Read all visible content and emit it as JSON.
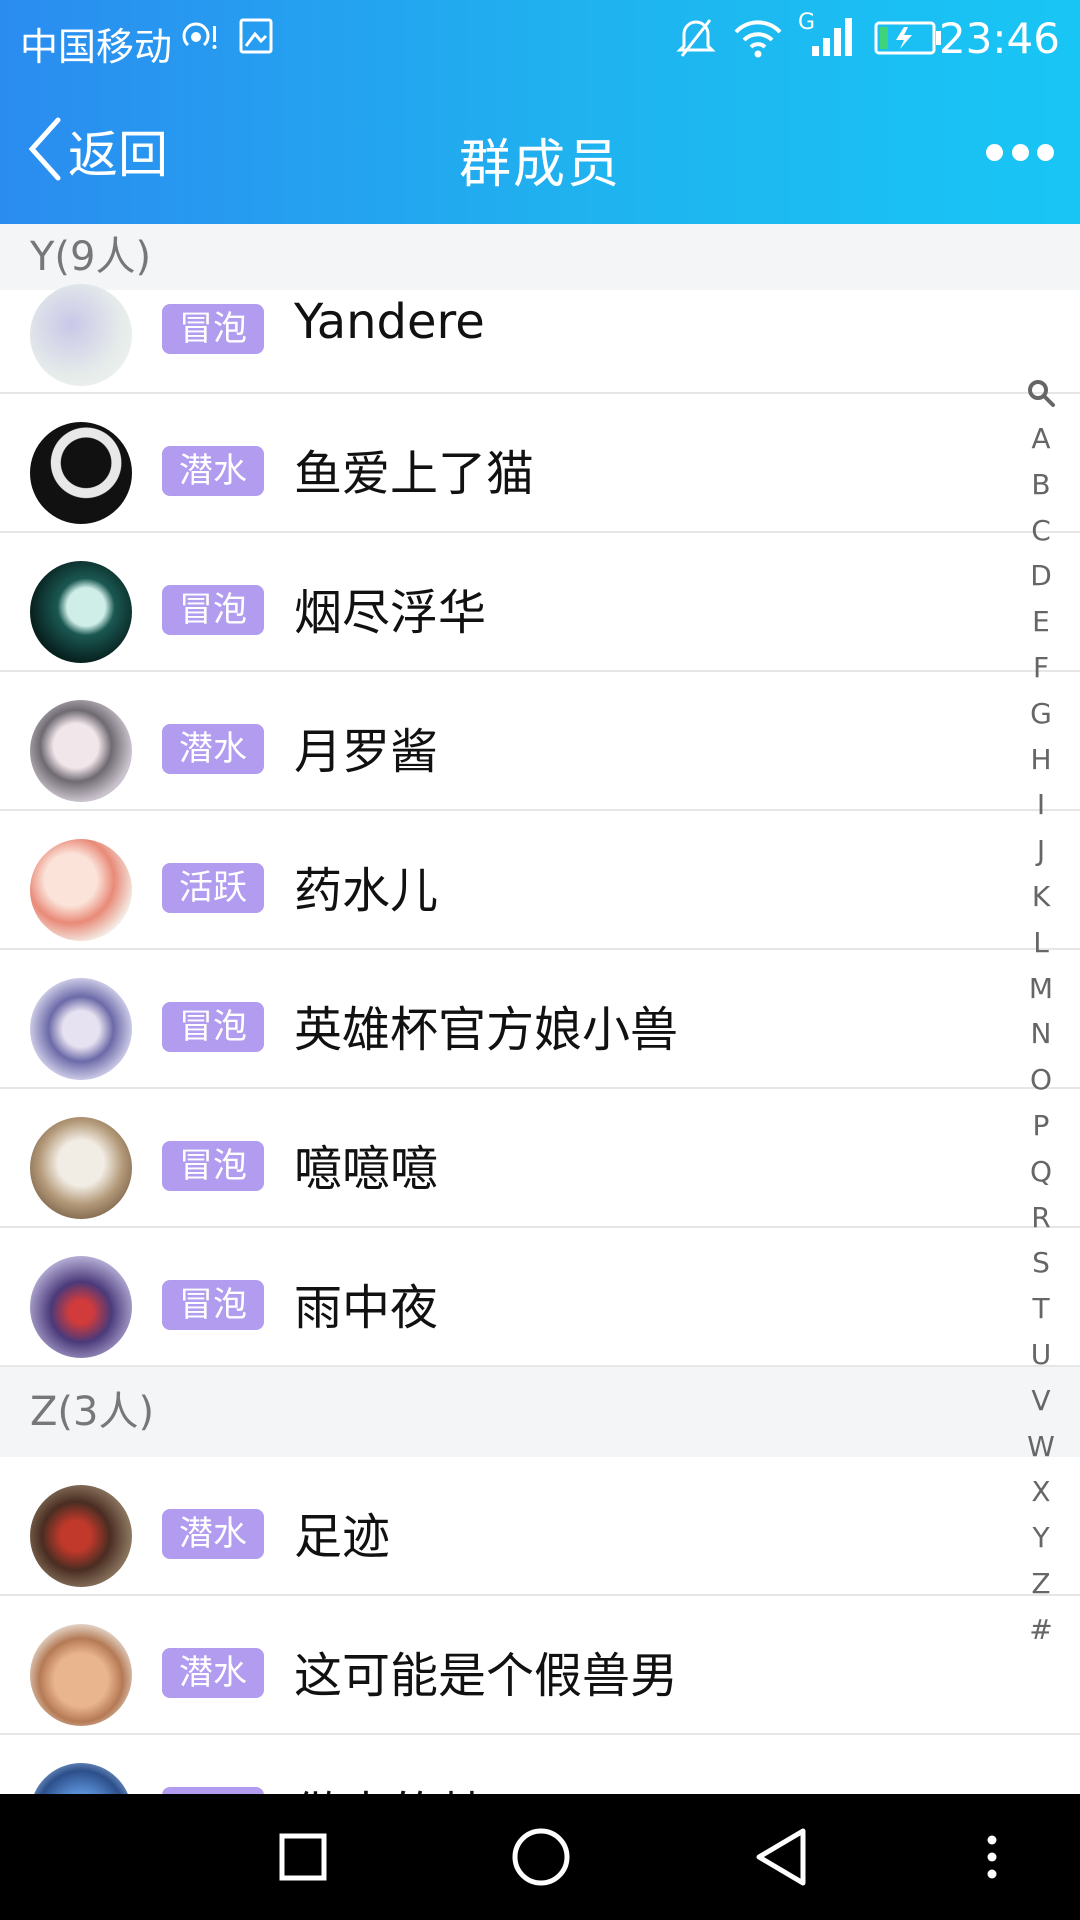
{
  "status_bar": {
    "carrier": "中国移动",
    "time": "23:46",
    "network": "G",
    "icons": [
      "hotspot-icon",
      "image-icon",
      "mute-icon",
      "wifi-icon",
      "signal-icon",
      "battery-charging-icon"
    ]
  },
  "header": {
    "back_label": "返回",
    "title": "群成员",
    "more_icon": "more-dots-icon"
  },
  "sections": [
    {
      "header": "Y(9人)",
      "members": [
        {
          "badge": "冒泡",
          "name": "Yandere"
        },
        {
          "badge": "潜水",
          "name": "鱼爱上了猫"
        },
        {
          "badge": "冒泡",
          "name": "烟尽浮华"
        },
        {
          "badge": "潜水",
          "name": "月罗酱"
        },
        {
          "badge": "活跃",
          "name": "药水儿"
        },
        {
          "badge": "冒泡",
          "name": "英雄杯官方娘小兽"
        },
        {
          "badge": "冒泡",
          "name": "噫噫噫"
        },
        {
          "badge": "冒泡",
          "name": "雨中夜"
        }
      ]
    },
    {
      "header": "Z(3人)",
      "members": [
        {
          "badge": "潜水",
          "name": "足迹"
        },
        {
          "badge": "潜水",
          "name": "这可能是个假兽男"
        },
        {
          "badge": "潜水",
          "name": "做毒的梦"
        }
      ]
    }
  ],
  "index_letters": [
    "A",
    "B",
    "C",
    "D",
    "E",
    "F",
    "G",
    "H",
    "I",
    "J",
    "K",
    "L",
    "M",
    "N",
    "O",
    "P",
    "Q",
    "R",
    "S",
    "T",
    "U",
    "V",
    "W",
    "X",
    "Y",
    "Z",
    "#"
  ],
  "colors": {
    "header_gradient_start": "#2b8cf0",
    "header_gradient_end": "#18c6f5",
    "badge": "#b19cf0",
    "section_bg": "#f4f5f7"
  },
  "system_nav": [
    "recent-apps-icon",
    "home-icon",
    "back-triangle-icon",
    "menu-dots-icon"
  ]
}
